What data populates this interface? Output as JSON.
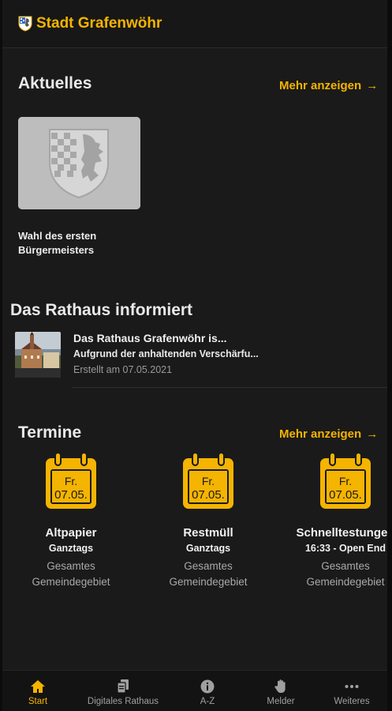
{
  "header": {
    "title": "Stadt Grafenwöhr",
    "crest_icon": "coat-of-arms-icon"
  },
  "aktuelles": {
    "title": "Aktuelles",
    "more_label": "Mehr anzeigen",
    "items": [
      {
        "caption": "Wahl des ersten Bürgermeisters",
        "image_icon": "coat-of-arms-placeholder"
      }
    ]
  },
  "rathaus": {
    "title": "Das Rathaus informiert",
    "items": [
      {
        "title": "Das Rathaus Grafenwöhr is...",
        "summary": "Aufgrund der anhaltenden Verschärfu...",
        "date": "Erstellt am 07.05.2021",
        "image_icon": "town-hall-photo"
      }
    ]
  },
  "termine": {
    "title": "Termine",
    "more_label": "Mehr anzeigen",
    "events": [
      {
        "day": "Fr.",
        "date": "07.05.",
        "name": "Altpapier",
        "time": "Ganztags",
        "area_1": "Gesamtes",
        "area_2": "Gemeindegebiet"
      },
      {
        "day": "Fr.",
        "date": "07.05.",
        "name": "Restmüll",
        "time": "Ganztags",
        "area_1": "Gesamtes",
        "area_2": "Gemeindegebiet"
      },
      {
        "day": "Fr.",
        "date": "07.05.",
        "name": "Schnelltestungen",
        "time": "16:33 - Open End",
        "area_1": "Gesamtes",
        "area_2": "Gemeindegebiet"
      }
    ]
  },
  "tabbar": {
    "items": [
      {
        "label": "Start",
        "icon": "home-icon",
        "active": true
      },
      {
        "label": "Digitales Rathaus",
        "icon": "documents-icon",
        "active": false
      },
      {
        "label": "A-Z",
        "icon": "info-icon",
        "active": false
      },
      {
        "label": "Melder",
        "icon": "hand-icon",
        "active": false
      },
      {
        "label": "Weiteres",
        "icon": "more-icon",
        "active": false
      }
    ]
  },
  "colors": {
    "accent": "#f4b400",
    "background": "#1a1a1a",
    "text": "#e9e9e9",
    "muted": "#a9a9a9"
  }
}
